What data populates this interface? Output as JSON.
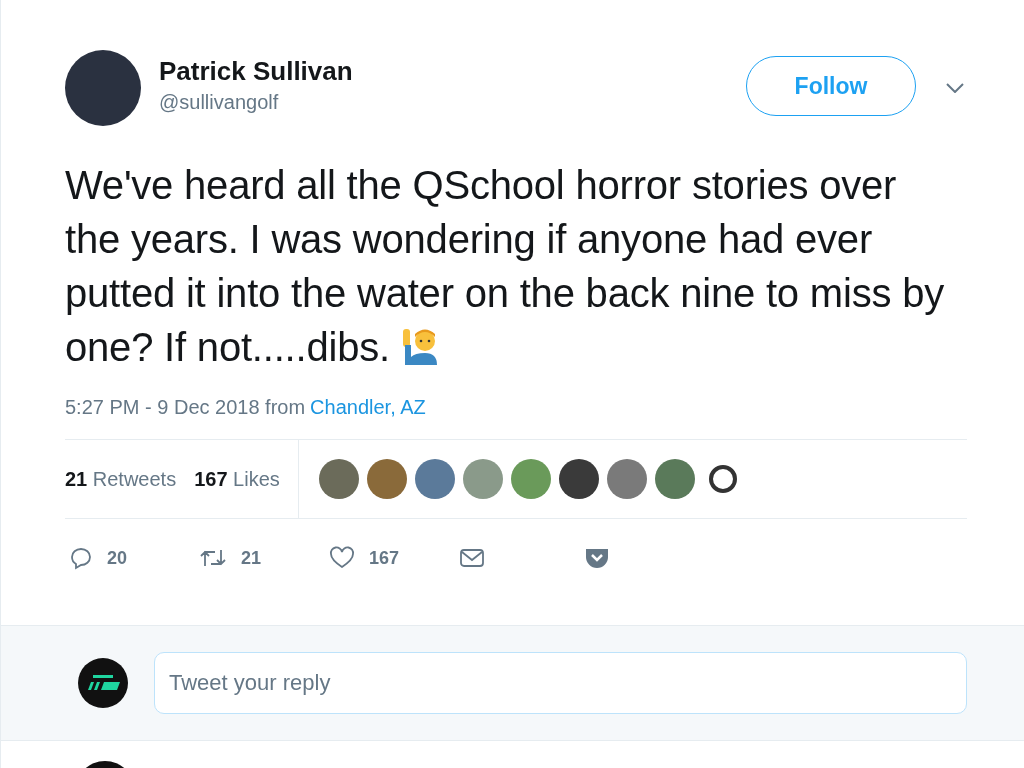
{
  "tweet": {
    "author": {
      "name": "Patrick Sullivan",
      "handle": "@sullivangolf"
    },
    "follow_button": "Follow",
    "text": "We've heard all the QSchool horror stories over the years. I was wondering if anyone had ever putted it into the water on the back nine to miss by one? If not.....dibs.",
    "timestamp": "5:27 PM - 9 Dec 2018 from",
    "location": "Chandler, AZ",
    "stats": [
      {
        "count": "21",
        "label": "Retweets"
      },
      {
        "count": "167",
        "label": "Likes"
      }
    ],
    "actions": [
      {
        "kind": "reply",
        "count": "20"
      },
      {
        "kind": "retweet",
        "count": "21"
      },
      {
        "kind": "like",
        "count": "167"
      },
      {
        "kind": "message"
      },
      {
        "kind": "pocket"
      }
    ]
  },
  "reply_box": {
    "placeholder": "Tweet your reply"
  }
}
